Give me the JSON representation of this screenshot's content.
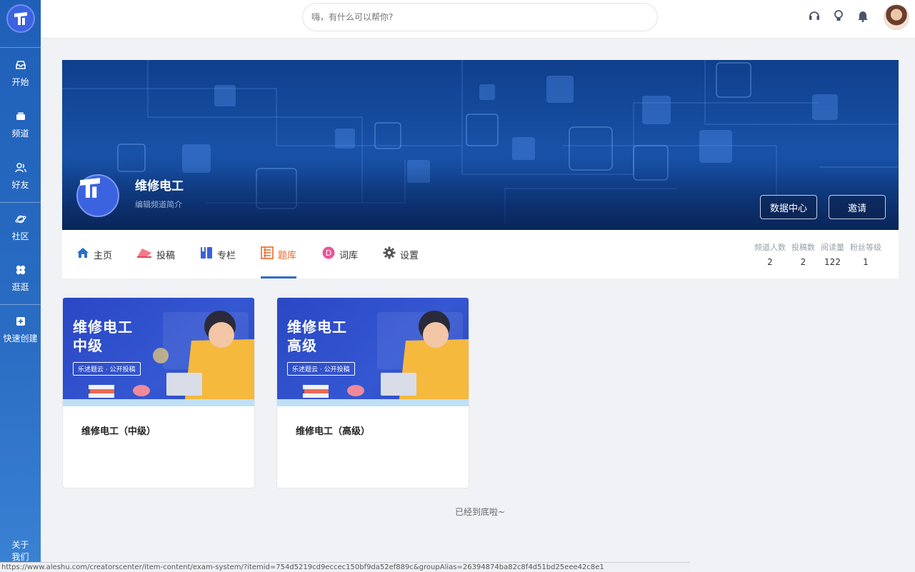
{
  "sidebar": {
    "items": [
      {
        "label": "开始",
        "icon": "inbox-icon"
      },
      {
        "label": "频道",
        "icon": "box-icon"
      },
      {
        "label": "好友",
        "icon": "users-icon"
      },
      {
        "label": "社区",
        "icon": "planet-icon"
      },
      {
        "label": "逛逛",
        "icon": "clover-icon"
      },
      {
        "label": "快速创建",
        "icon": "add-square-icon"
      }
    ],
    "about_line1": "关于",
    "about_line2": "我们"
  },
  "header": {
    "search_placeholder": "嗨，有什么可以帮你?"
  },
  "channel": {
    "title": "维修电工",
    "description": "编辑频道简介",
    "data_center_label": "数据中心",
    "invite_label": "邀请"
  },
  "tabs": [
    {
      "label": "主页",
      "icon": "home-icon",
      "color": "#2f6fc6"
    },
    {
      "label": "投稿",
      "icon": "submit-icon",
      "color": "#e0455a"
    },
    {
      "label": "专栏",
      "icon": "book-icon",
      "color": "#3b62d8"
    },
    {
      "label": "题库",
      "icon": "question-bank-icon",
      "color": "#e86a2a",
      "active": true
    },
    {
      "label": "词库",
      "icon": "d-circle-icon",
      "color": "#e8559a"
    },
    {
      "label": "设置",
      "icon": "gear-icon",
      "color": "#555"
    }
  ],
  "stats": [
    {
      "label": "频道人数",
      "value": "2"
    },
    {
      "label": "投稿数",
      "value": "2"
    },
    {
      "label": "阅读量",
      "value": "122"
    },
    {
      "label": "粉丝等级",
      "value": "1"
    }
  ],
  "cards": [
    {
      "thumb_line1": "维修电工",
      "thumb_line2": "中级",
      "thumb_tag": "乐述题云 · 公开投稿",
      "title": "维修电工（中级）"
    },
    {
      "thumb_line1": "维修电工",
      "thumb_line2": "高级",
      "thumb_tag": "乐述题云 · 公开投稿",
      "title": "维修电工（高级）"
    }
  ],
  "end_text": "已经到底啦~",
  "status_url": "https://www.aleshu.com/creatorscenter/item-content/exam-system/?itemid=754d5219cd9eccec150bf9da52ef889c&groupAlias=26394874ba82c8f4d51bd25eee42c8e1"
}
